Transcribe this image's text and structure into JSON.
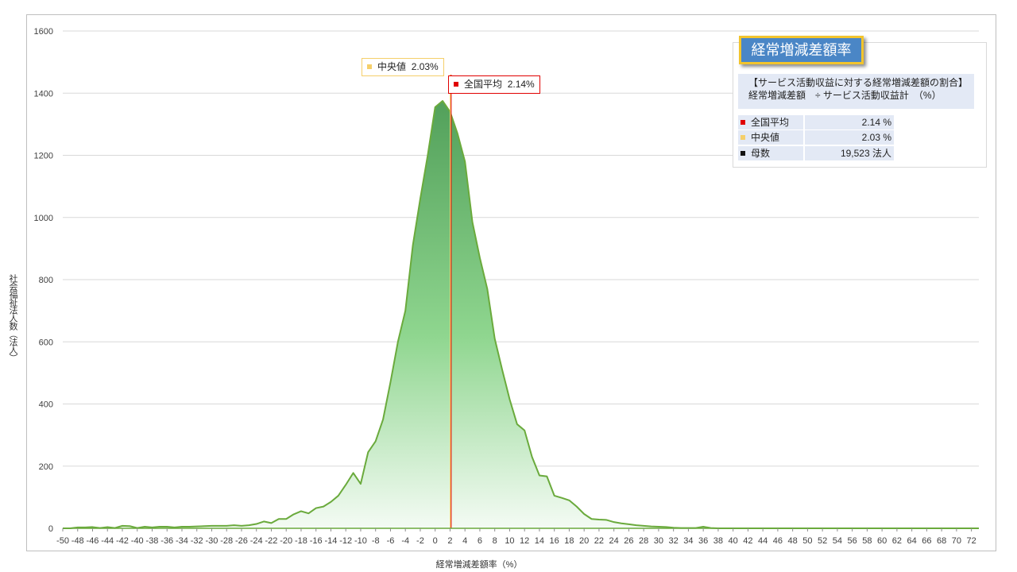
{
  "chart_data": {
    "type": "area",
    "title": "",
    "xlabel": "経常増減差額率（%）",
    "ylabel": "社会福祉法人数（法人）",
    "xlim": [
      -50,
      73
    ],
    "ylim": [
      0,
      1600
    ],
    "yticks": [
      0,
      200,
      400,
      600,
      800,
      1000,
      1200,
      1400,
      1600
    ],
    "xticks": [
      -50,
      -48,
      -46,
      -44,
      -42,
      -40,
      -38,
      -36,
      -34,
      -32,
      -30,
      -28,
      -26,
      -24,
      -22,
      -20,
      -18,
      -16,
      -14,
      -12,
      -10,
      -8,
      -6,
      -4,
      -2,
      0,
      2,
      4,
      6,
      8,
      10,
      12,
      14,
      16,
      18,
      20,
      22,
      24,
      26,
      28,
      30,
      32,
      34,
      36,
      38,
      40,
      42,
      44,
      46,
      48,
      50,
      52,
      54,
      56,
      58,
      60,
      62,
      64,
      66,
      68,
      70,
      72
    ],
    "grid": true,
    "series": [
      {
        "color": "#6aaa3c",
        "x": [
          -50,
          -49,
          -48,
          -47,
          -46,
          -45,
          -44,
          -43,
          -42,
          -41,
          -40,
          -39,
          -38,
          -37,
          -36,
          -35,
          -34,
          -33,
          -32,
          -31,
          -30,
          -29,
          -28,
          -27,
          -26,
          -25,
          -24,
          -23,
          -22,
          -21,
          -20,
          -19,
          -18,
          -17,
          -16,
          -15,
          -14,
          -13,
          -12,
          -11,
          -10,
          -9,
          -8,
          -7,
          -6,
          -5,
          -4,
          -3,
          -2,
          -1,
          0,
          1,
          2,
          3,
          4,
          5,
          6,
          7,
          8,
          9,
          10,
          11,
          12,
          13,
          14,
          15,
          16,
          17,
          18,
          19,
          20,
          21,
          22,
          23,
          24,
          25,
          26,
          27,
          28,
          29,
          30,
          31,
          32,
          33,
          34,
          35,
          36,
          37,
          38,
          39,
          40,
          41,
          42,
          43,
          44,
          45,
          46,
          47,
          48,
          49,
          50,
          51,
          52,
          53,
          54,
          55,
          56,
          57,
          58,
          59,
          60,
          61,
          62,
          63,
          64,
          65,
          66,
          67,
          68,
          69,
          70,
          71,
          72,
          73
        ],
        "values": [
          0,
          0,
          3,
          3,
          4,
          1,
          4,
          1,
          8,
          7,
          1,
          5,
          3,
          5,
          5,
          3,
          5,
          5,
          6,
          7,
          8,
          8,
          8,
          10,
          8,
          10,
          14,
          22,
          17,
          30,
          30,
          45,
          55,
          48,
          65,
          70,
          85,
          105,
          140,
          178,
          143,
          245,
          280,
          350,
          470,
          600,
          700,
          910,
          1060,
          1200,
          1355,
          1375,
          1340,
          1270,
          1180,
          985,
          870,
          770,
          610,
          510,
          415,
          335,
          315,
          230,
          170,
          167,
          105,
          98,
          90,
          70,
          46,
          30,
          28,
          27,
          20,
          16,
          13,
          10,
          8,
          6,
          5,
          4,
          2,
          1,
          1,
          1,
          5,
          1,
          0,
          0,
          0,
          0,
          0,
          0,
          0,
          0,
          0,
          0,
          0,
          0,
          0,
          0,
          0,
          0,
          0,
          0,
          0,
          0,
          0,
          0,
          0,
          0,
          0,
          0,
          0,
          0,
          0,
          0,
          0,
          0,
          0,
          0,
          0,
          0
        ]
      }
    ],
    "markers": [
      {
        "label": "全国平均",
        "value": "2.14%",
        "x": 2.14,
        "color": "#e00000"
      },
      {
        "label": "中央値",
        "value": "2.03%",
        "x": 2.03,
        "color": "#f5cf6a"
      }
    ]
  },
  "callouts": {
    "median_label": "中央値",
    "median_value": "2.03%",
    "mean_label": "全国平均",
    "mean_value": "2.14%"
  },
  "info": {
    "title": "経常増減差額率",
    "formula_line1": "【サービス活動収益に対する経常増減差額の割合】",
    "formula_line2": "経常増減差額　÷ サービス活動収益計　（%）",
    "rows": [
      {
        "label": "全国平均",
        "value": "2.14 %",
        "color": "#e00000"
      },
      {
        "label": "中央値",
        "value": "2.03 %",
        "color": "#f5cf6a"
      },
      {
        "label": "母数",
        "value": "19,523 法人",
        "color": "#111111"
      }
    ]
  }
}
